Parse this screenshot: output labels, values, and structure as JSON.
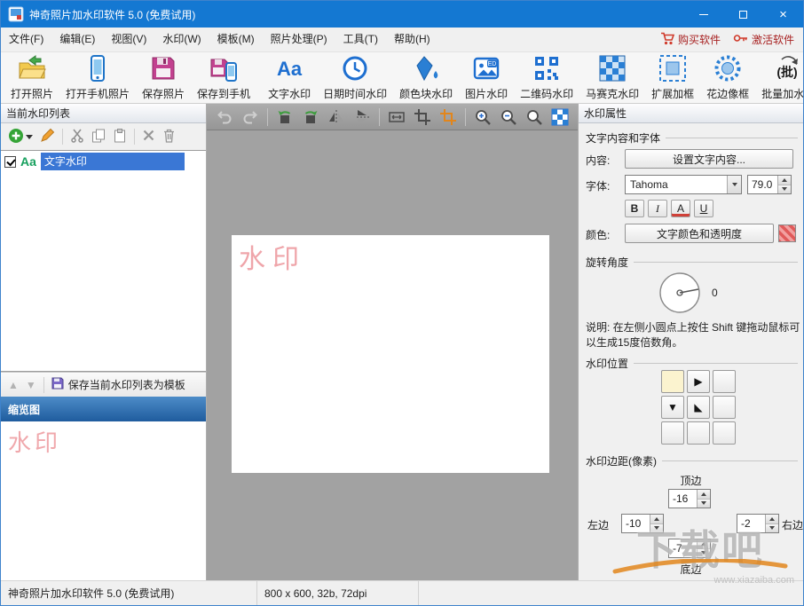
{
  "window": {
    "title": "神奇照片加水印软件 5.0 (免费试用)",
    "status_left": "神奇照片加水印软件 5.0 (免费试用)",
    "status_center": "800 x 600, 32b, 72dpi"
  },
  "menu": {
    "items": [
      {
        "label": "文件(F)"
      },
      {
        "label": "编辑(E)"
      },
      {
        "label": "视图(V)"
      },
      {
        "label": "水印(W)"
      },
      {
        "label": "模板(M)"
      },
      {
        "label": "照片处理(P)"
      },
      {
        "label": "工具(T)"
      },
      {
        "label": "帮助(H)"
      }
    ],
    "buy_label": "购买软件",
    "activate_label": "激活软件"
  },
  "toolbar": {
    "aa_icon_text": "Aa",
    "ed_badge_text": "ED",
    "batch_icon_text": "(批)",
    "items": [
      {
        "label": "打开照片",
        "icon": "open-photo-icon"
      },
      {
        "label": "打开手机照片",
        "icon": "open-phone-photo-icon"
      },
      {
        "label": "保存照片",
        "icon": "save-photo-icon"
      },
      {
        "label": "保存到手机",
        "icon": "save-to-phone-icon"
      },
      {
        "label": "文字水印",
        "icon": "text-watermark-icon"
      },
      {
        "label": "日期时间水印",
        "icon": "datetime-watermark-icon"
      },
      {
        "label": "颜色块水印",
        "icon": "color-block-watermark-icon"
      },
      {
        "label": "图片水印",
        "icon": "image-watermark-icon"
      },
      {
        "label": "二维码水印",
        "icon": "qrcode-watermark-icon"
      },
      {
        "label": "马赛克水印",
        "icon": "mosaic-watermark-icon"
      },
      {
        "label": "扩展加框",
        "icon": "extend-frame-icon"
      },
      {
        "label": "花边像框",
        "icon": "lace-frame-icon"
      },
      {
        "label": "批量加水印",
        "icon": "batch-watermark-icon"
      }
    ]
  },
  "left_panel": {
    "header": "当前水印列表",
    "list_items": [
      {
        "icon_text": "Aa",
        "label": "文字水印",
        "checked": true,
        "selected": true
      }
    ],
    "save_template_label": "保存当前水印列表为模板",
    "thumbnail_header": "缩览图",
    "thumbnail_watermark": "水印"
  },
  "canvas": {
    "watermark_text": "水印"
  },
  "properties": {
    "header": "水印属性",
    "section_font": "文字内容和字体",
    "content_label": "内容:",
    "content_button": "设置文字内容...",
    "font_label": "字体:",
    "font_value": "Tahoma",
    "font_size": "79.0",
    "format": {
      "bold": "B",
      "italic": "I",
      "color": "A",
      "underline": "U"
    },
    "color_label": "颜色:",
    "color_button": "文字颜色和透明度",
    "section_rotation": "旋转角度",
    "rotation_value": "0",
    "rotation_note": "说明: 在左侧小圆点上按住 Shift 键拖动鼠标可以生成15度倍数角。",
    "section_position": "水印位置",
    "position_arrows": {
      "right": "▶",
      "down": "▼",
      "diag": "◣"
    },
    "section_margin": "水印边距(像素)",
    "margin_top_label": "顶边",
    "margin_top": "-16",
    "margin_left_label": "左边",
    "margin_left": "-10",
    "margin_right_label": "右边",
    "margin_right": "-2",
    "margin_bottom_label": "底边",
    "margin_bottom": "-7"
  },
  "site_watermark": {
    "text": "下载吧",
    "url": "www.xiazaiba.com"
  }
}
